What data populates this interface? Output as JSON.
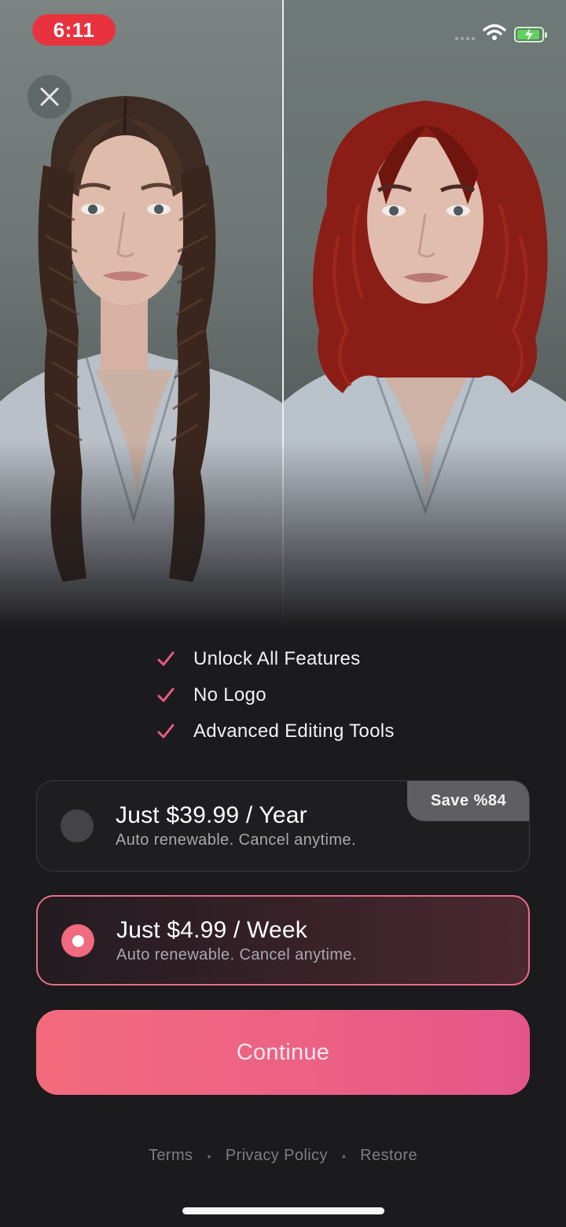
{
  "status_bar": {
    "time": "6:11",
    "accent": "#e8333e",
    "icons": [
      "cellular-signal-icon",
      "wifi-icon",
      "battery-charging-icon"
    ]
  },
  "hero": {
    "images": [
      "before-portrait-braided-brown-hair",
      "after-portrait-wavy-red-hair"
    ]
  },
  "close_button": {
    "icon": "close-icon"
  },
  "features": [
    {
      "text": "Unlock All Features"
    },
    {
      "text": "No Logo"
    },
    {
      "text": "Advanced Editing Tools"
    }
  ],
  "plans": [
    {
      "title": "Just $39.99 / Year",
      "subtitle": "Auto renewable. Cancel anytime.",
      "badge": "Save %84",
      "selected": false
    },
    {
      "title": "Just $4.99 / Week",
      "subtitle": "Auto renewable. Cancel anytime.",
      "selected": true
    }
  ],
  "continue_label": "Continue",
  "footer": {
    "links": [
      "Terms",
      "Privacy Policy",
      "Restore"
    ],
    "separator": "•"
  },
  "colors": {
    "accent_pink": "#ec6184",
    "background": "#1b1a1d",
    "check": "#ea5a82"
  }
}
